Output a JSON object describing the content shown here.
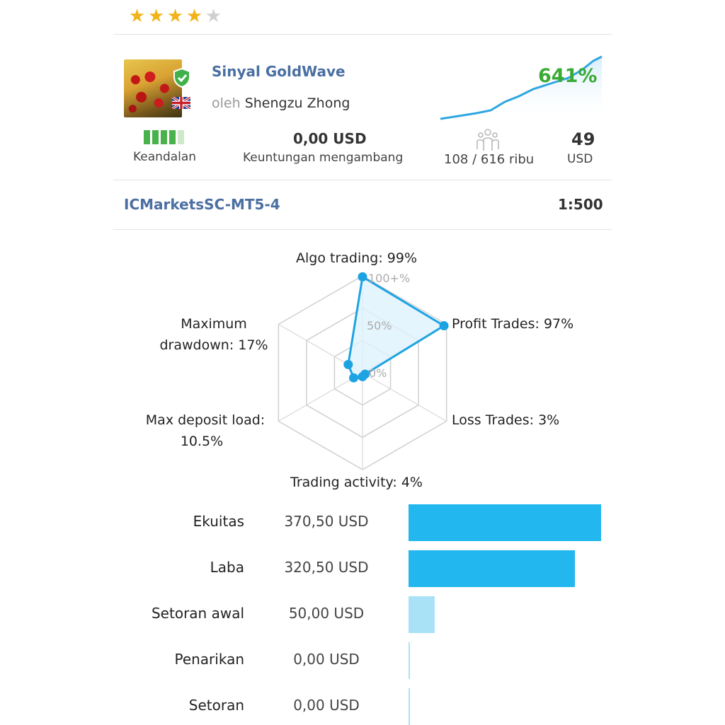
{
  "rating": {
    "stars_filled": 4,
    "stars_total": 5,
    "star_glyph": "★",
    "filled_color": "#f2b318",
    "empty_color": "#cfcfcf"
  },
  "signal": {
    "title": "Sinyal GoldWave",
    "author_prefix": "oleh",
    "author": "Shengzu Zhong",
    "gain": "641%",
    "verified_icon": "shield-check-icon",
    "country_flag_icon": "uk-flag-icon"
  },
  "stats": {
    "reliability": {
      "label": "Keandalan",
      "bars_filled": 4,
      "bars_total": 5
    },
    "floating": {
      "value": "0,00 USD",
      "label": "Keuntungan mengambang"
    },
    "subscribers": {
      "value": "108 / 616 ribu",
      "icon": "subscribers-icon"
    },
    "price": {
      "value": "49",
      "unit": "USD"
    }
  },
  "account": {
    "broker": "ICMarketsSC-MT5-4",
    "leverage": "1:500"
  },
  "radar": {
    "scale_labels": [
      "0%",
      "50%",
      "100+%"
    ],
    "axes": [
      {
        "label": "Algo trading: 99%",
        "value": 99
      },
      {
        "label": "Profit Trades: 97%",
        "value": 97
      },
      {
        "label": "Loss Trades: 3%",
        "value": 3
      },
      {
        "label": "Trading activity: 4%",
        "value": 4
      },
      {
        "label_line1": "Max deposit load:",
        "label_line2": "10.5%",
        "value": 10.5
      },
      {
        "label_line1": "Maximum",
        "label_line2": "drawdown: 17%",
        "value": 17
      }
    ]
  },
  "balances": [
    {
      "label": "Ekuitas",
      "value": "370,50 USD",
      "amount": 370.5,
      "color": "#22b7ee"
    },
    {
      "label": "Laba",
      "value": "320,50 USD",
      "amount": 320.5,
      "color": "#22b7ee"
    },
    {
      "label": "Setoran awal",
      "value": "50,00 USD",
      "amount": 50.0,
      "color": "#a9e2f7"
    },
    {
      "label": "Penarikan",
      "value": "0,00 USD",
      "amount": 0.0,
      "color": "#a9e2f7"
    },
    {
      "label": "Setoran",
      "value": "0,00 USD",
      "amount": 0.0,
      "color": "#a9e2f7"
    }
  ]
}
